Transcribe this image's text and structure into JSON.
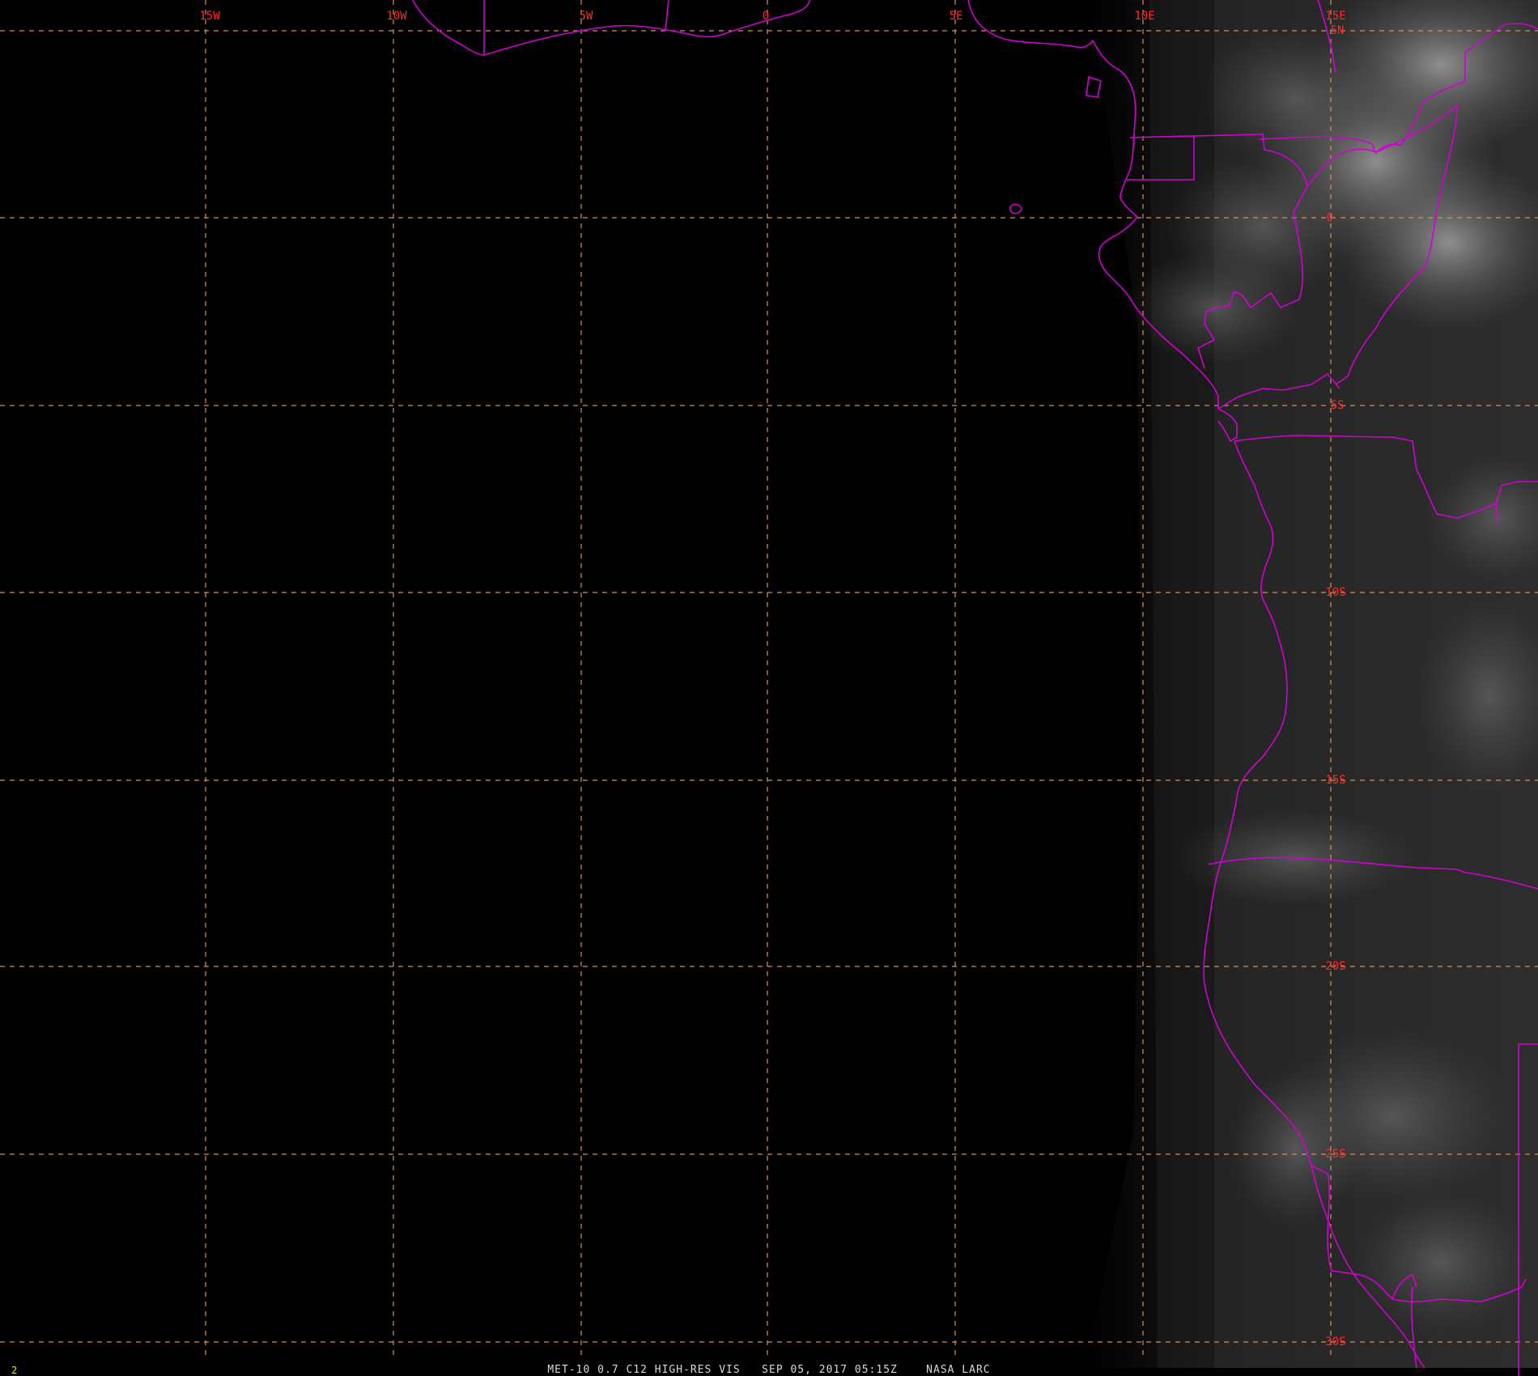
{
  "map": {
    "longitude_labels": [
      "15W",
      "10W",
      "5W",
      "0",
      "5E",
      "10E",
      "15E"
    ],
    "latitude_labels": [
      "5N",
      "0",
      "5S",
      "10S",
      "15S",
      "20S",
      "25S",
      "30S"
    ],
    "colors": {
      "background": "#000000",
      "grid": "#d2915a",
      "grid_labels": "#ff2a2a",
      "borders": "#d200d2",
      "caption": "#d8d8d8",
      "frame_number": "#e8e800"
    },
    "grid_style": "dashed"
  },
  "footer": {
    "frame_number": "2",
    "caption": "MET-10 0.7 C12 HIGH-RES VIS   SEP 05, 2017 05:15Z    NASA LARC"
  }
}
